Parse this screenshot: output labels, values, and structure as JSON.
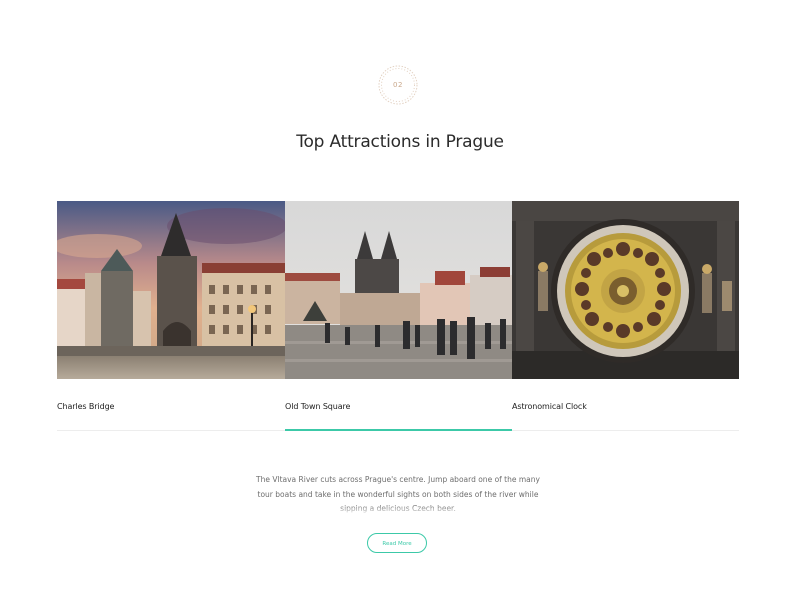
{
  "badge": {
    "number": "02"
  },
  "section": {
    "title": "Top Attractions in Prague"
  },
  "attractions": [
    {
      "name": "Charles Bridge",
      "active": false
    },
    {
      "name": "Old Town Square",
      "active": true
    },
    {
      "name": "Astronomical Clock",
      "active": false
    }
  ],
  "description": "The Vltava River cuts across Prague's centre. Jump aboard one of the many tour boats and take in the wonderful sights on both sides of the river while sipping a delicious Czech beer.",
  "cta": {
    "label": "Read More"
  },
  "colors": {
    "accent": "#3cc9a8",
    "badge": "#c9a78a",
    "title": "#2b2b2b"
  }
}
